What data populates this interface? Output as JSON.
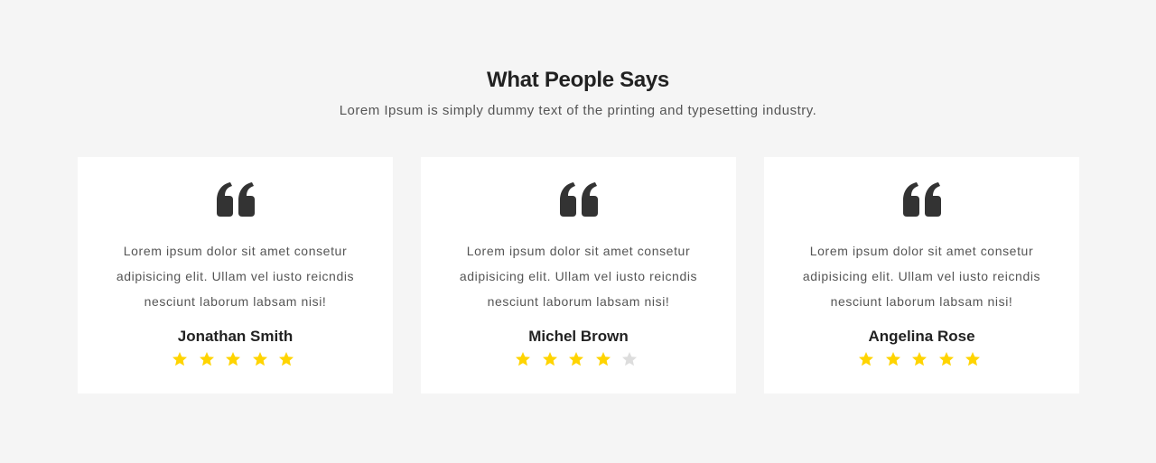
{
  "section": {
    "title": "What People Says",
    "subtitle": "Lorem Ipsum is simply dummy text of the printing and typesetting industry."
  },
  "colors": {
    "background": "#f5f5f5",
    "card": "#ffffff",
    "star_filled": "#ffd400",
    "star_empty": "#dddddd",
    "quote_icon": "#333333"
  },
  "testimonials": [
    {
      "icon": "quote-icon",
      "quote": "Lorem ipsum dolor sit amet consetur adipisicing elit. Ullam vel iusto reicndis nesciunt laborum labsam nisi!",
      "name": "Jonathan Smith",
      "rating": 5,
      "max_rating": 5
    },
    {
      "icon": "quote-icon",
      "quote": "Lorem ipsum dolor sit amet consetur adipisicing elit. Ullam vel iusto reicndis nesciunt laborum labsam nisi!",
      "name": "Michel Brown",
      "rating": 4,
      "max_rating": 5
    },
    {
      "icon": "quote-icon",
      "quote": "Lorem ipsum dolor sit amet consetur adipisicing elit. Ullam vel iusto reicndis nesciunt laborum labsam nisi!",
      "name": "Angelina Rose",
      "rating": 5,
      "max_rating": 5
    }
  ]
}
